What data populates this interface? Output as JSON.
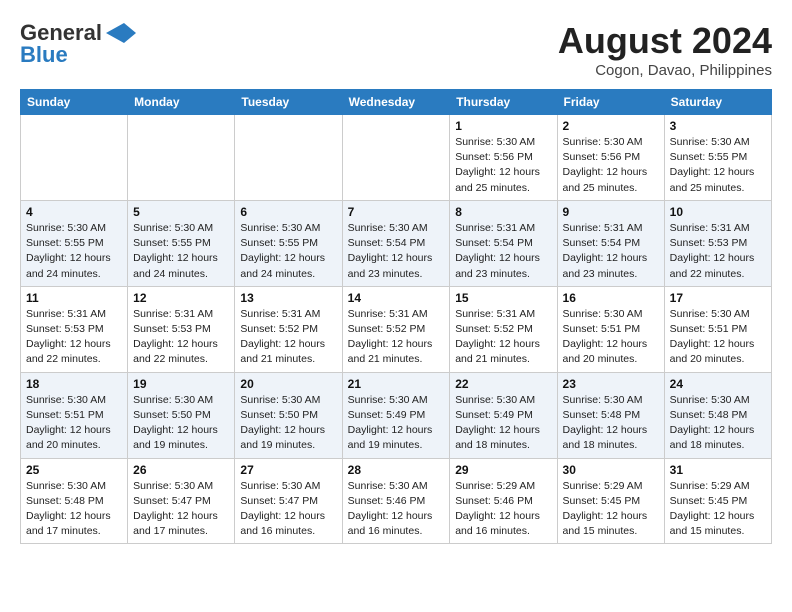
{
  "header": {
    "logo_line1": "General",
    "logo_line2": "Blue",
    "month_year": "August 2024",
    "location": "Cogon, Davao, Philippines"
  },
  "days_of_week": [
    "Sunday",
    "Monday",
    "Tuesday",
    "Wednesday",
    "Thursday",
    "Friday",
    "Saturday"
  ],
  "weeks": [
    [
      {
        "day": "",
        "info": ""
      },
      {
        "day": "",
        "info": ""
      },
      {
        "day": "",
        "info": ""
      },
      {
        "day": "",
        "info": ""
      },
      {
        "day": "1",
        "info": "Sunrise: 5:30 AM\nSunset: 5:56 PM\nDaylight: 12 hours\nand 25 minutes."
      },
      {
        "day": "2",
        "info": "Sunrise: 5:30 AM\nSunset: 5:56 PM\nDaylight: 12 hours\nand 25 minutes."
      },
      {
        "day": "3",
        "info": "Sunrise: 5:30 AM\nSunset: 5:55 PM\nDaylight: 12 hours\nand 25 minutes."
      }
    ],
    [
      {
        "day": "4",
        "info": "Sunrise: 5:30 AM\nSunset: 5:55 PM\nDaylight: 12 hours\nand 24 minutes."
      },
      {
        "day": "5",
        "info": "Sunrise: 5:30 AM\nSunset: 5:55 PM\nDaylight: 12 hours\nand 24 minutes."
      },
      {
        "day": "6",
        "info": "Sunrise: 5:30 AM\nSunset: 5:55 PM\nDaylight: 12 hours\nand 24 minutes."
      },
      {
        "day": "7",
        "info": "Sunrise: 5:30 AM\nSunset: 5:54 PM\nDaylight: 12 hours\nand 23 minutes."
      },
      {
        "day": "8",
        "info": "Sunrise: 5:31 AM\nSunset: 5:54 PM\nDaylight: 12 hours\nand 23 minutes."
      },
      {
        "day": "9",
        "info": "Sunrise: 5:31 AM\nSunset: 5:54 PM\nDaylight: 12 hours\nand 23 minutes."
      },
      {
        "day": "10",
        "info": "Sunrise: 5:31 AM\nSunset: 5:53 PM\nDaylight: 12 hours\nand 22 minutes."
      }
    ],
    [
      {
        "day": "11",
        "info": "Sunrise: 5:31 AM\nSunset: 5:53 PM\nDaylight: 12 hours\nand 22 minutes."
      },
      {
        "day": "12",
        "info": "Sunrise: 5:31 AM\nSunset: 5:53 PM\nDaylight: 12 hours\nand 22 minutes."
      },
      {
        "day": "13",
        "info": "Sunrise: 5:31 AM\nSunset: 5:52 PM\nDaylight: 12 hours\nand 21 minutes."
      },
      {
        "day": "14",
        "info": "Sunrise: 5:31 AM\nSunset: 5:52 PM\nDaylight: 12 hours\nand 21 minutes."
      },
      {
        "day": "15",
        "info": "Sunrise: 5:31 AM\nSunset: 5:52 PM\nDaylight: 12 hours\nand 21 minutes."
      },
      {
        "day": "16",
        "info": "Sunrise: 5:30 AM\nSunset: 5:51 PM\nDaylight: 12 hours\nand 20 minutes."
      },
      {
        "day": "17",
        "info": "Sunrise: 5:30 AM\nSunset: 5:51 PM\nDaylight: 12 hours\nand 20 minutes."
      }
    ],
    [
      {
        "day": "18",
        "info": "Sunrise: 5:30 AM\nSunset: 5:51 PM\nDaylight: 12 hours\nand 20 minutes."
      },
      {
        "day": "19",
        "info": "Sunrise: 5:30 AM\nSunset: 5:50 PM\nDaylight: 12 hours\nand 19 minutes."
      },
      {
        "day": "20",
        "info": "Sunrise: 5:30 AM\nSunset: 5:50 PM\nDaylight: 12 hours\nand 19 minutes."
      },
      {
        "day": "21",
        "info": "Sunrise: 5:30 AM\nSunset: 5:49 PM\nDaylight: 12 hours\nand 19 minutes."
      },
      {
        "day": "22",
        "info": "Sunrise: 5:30 AM\nSunset: 5:49 PM\nDaylight: 12 hours\nand 18 minutes."
      },
      {
        "day": "23",
        "info": "Sunrise: 5:30 AM\nSunset: 5:48 PM\nDaylight: 12 hours\nand 18 minutes."
      },
      {
        "day": "24",
        "info": "Sunrise: 5:30 AM\nSunset: 5:48 PM\nDaylight: 12 hours\nand 18 minutes."
      }
    ],
    [
      {
        "day": "25",
        "info": "Sunrise: 5:30 AM\nSunset: 5:48 PM\nDaylight: 12 hours\nand 17 minutes."
      },
      {
        "day": "26",
        "info": "Sunrise: 5:30 AM\nSunset: 5:47 PM\nDaylight: 12 hours\nand 17 minutes."
      },
      {
        "day": "27",
        "info": "Sunrise: 5:30 AM\nSunset: 5:47 PM\nDaylight: 12 hours\nand 16 minutes."
      },
      {
        "day": "28",
        "info": "Sunrise: 5:30 AM\nSunset: 5:46 PM\nDaylight: 12 hours\nand 16 minutes."
      },
      {
        "day": "29",
        "info": "Sunrise: 5:29 AM\nSunset: 5:46 PM\nDaylight: 12 hours\nand 16 minutes."
      },
      {
        "day": "30",
        "info": "Sunrise: 5:29 AM\nSunset: 5:45 PM\nDaylight: 12 hours\nand 15 minutes."
      },
      {
        "day": "31",
        "info": "Sunrise: 5:29 AM\nSunset: 5:45 PM\nDaylight: 12 hours\nand 15 minutes."
      }
    ]
  ]
}
